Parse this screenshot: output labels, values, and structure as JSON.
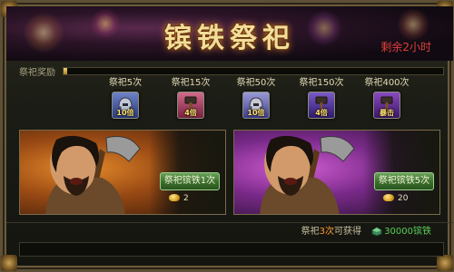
{
  "banner": {
    "title": "镔铁祭祀",
    "remaining": "剩余2小时"
  },
  "reward": {
    "label": "祭祀奖励",
    "progress": 0.01
  },
  "milestones": [
    {
      "label": "祭祀5次",
      "badge": "10倍",
      "icon": "helmet-icon",
      "color": "#6e82c8"
    },
    {
      "label": "祭祀15次",
      "badge": "4倍",
      "icon": "hammer-icon",
      "color": "#c8506e"
    },
    {
      "label": "祭祀50次",
      "badge": "10倍",
      "icon": "helmet-icon",
      "color": "#8c8ccf"
    },
    {
      "label": "祭祀150次",
      "badge": "4倍",
      "icon": "hammer-icon",
      "color": "#6a4ab8"
    },
    {
      "label": "祭祀400次",
      "badge": "暴击",
      "icon": "hammer-icon",
      "color": "#7a3ab0"
    }
  ],
  "offers": [
    {
      "button": "祭祀镔铁1次",
      "cost": "2",
      "theme": "orange"
    },
    {
      "button": "祭祀镔铁5次",
      "cost": "20",
      "theme": "purple"
    }
  ],
  "footer": {
    "prefix": "祭祀",
    "count": "3次",
    "suffix": "可获得",
    "amount": "30000镔铁"
  }
}
